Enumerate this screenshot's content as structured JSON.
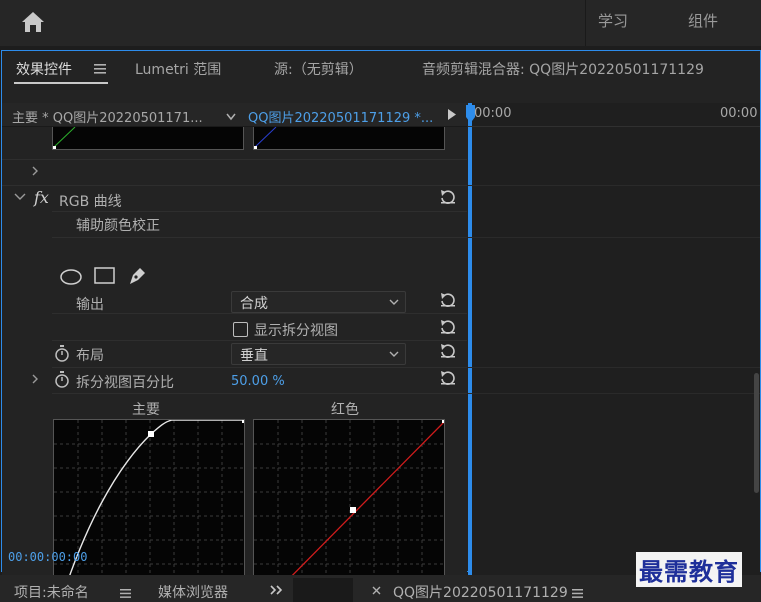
{
  "topbar": {
    "workspaces": [
      "学习",
      "组件"
    ]
  },
  "panel_tabs": {
    "effects_controls": "效果控件",
    "lumetri_scopes": "Lumetri 范围",
    "source": "源:（无剪辑）",
    "audio_mixer": "音频剪辑混合器: QQ图片20220501171129"
  },
  "sequence_bar": {
    "master": "主要 * QQ图片20220501171...",
    "clip": "QQ图片20220501171129 *...",
    "timeline_start": "00:00",
    "timeline_end": "00:00"
  },
  "effects": {
    "secondary_color": "辅助颜色校正",
    "rgb_curves": "RGB 曲线",
    "fx_glyph": "fx",
    "output_label": "输出",
    "output_value": "合成",
    "split_view_label": "显示拆分视图",
    "layout_label": "布局",
    "layout_value": "垂直",
    "split_percent_label": "拆分视图百分比",
    "split_percent_value": "50.00 %",
    "curve_master_label": "主要",
    "curve_red_label": "红色"
  },
  "timecode": "00:00:00:00",
  "bottom_tabs": {
    "project": "项目:未命名",
    "media_browser": "媒体浏览器",
    "timeline_clip": "QQ图片20220501171129"
  },
  "watermark": "最需教育",
  "colors": {
    "accent_blue": "#2d8ceb",
    "value_blue": "#4d9fe8",
    "red_curve": "#d01c1c"
  }
}
